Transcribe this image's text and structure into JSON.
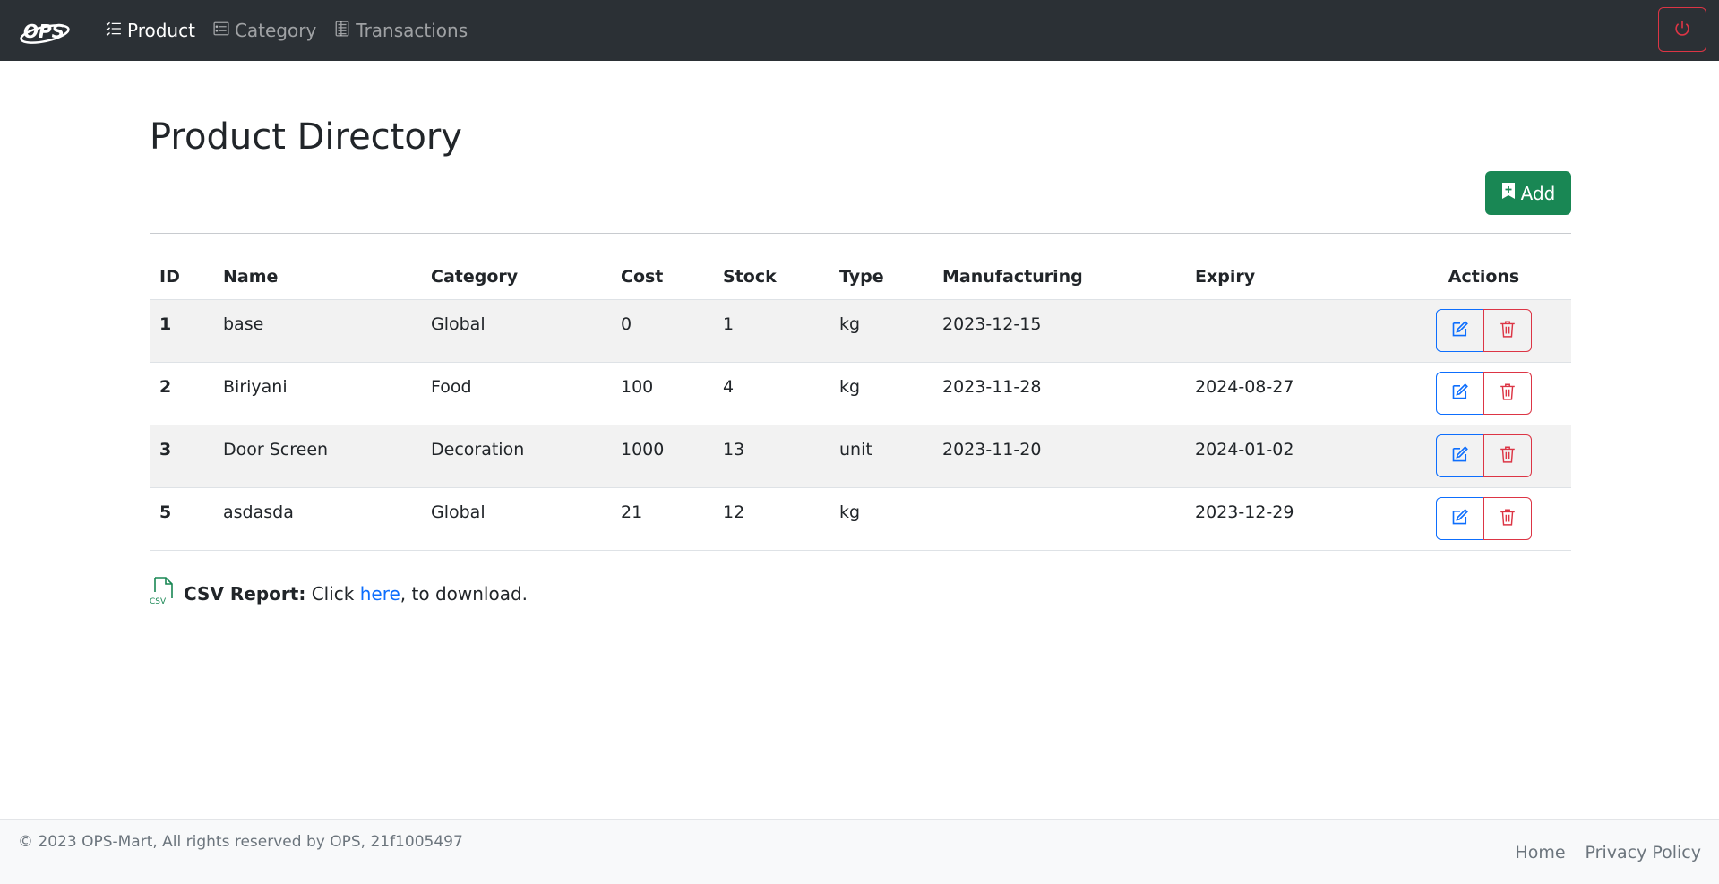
{
  "nav": {
    "brand": "OPS",
    "items": [
      {
        "label": "Product",
        "icon": "list-check-icon",
        "active": true
      },
      {
        "label": "Category",
        "icon": "card-list-icon",
        "active": false
      },
      {
        "label": "Transactions",
        "icon": "ledger-icon",
        "active": false
      }
    ],
    "power_icon": "power-icon"
  },
  "main": {
    "title": "Product Directory",
    "add_label": "Add",
    "table": {
      "headers": [
        "ID",
        "Name",
        "Category",
        "Cost",
        "Stock",
        "Type",
        "Manufacturing",
        "Expiry",
        "Actions"
      ],
      "rows": [
        {
          "id": "1",
          "name": "base",
          "category": "Global",
          "cost": "0",
          "stock": "1",
          "type": "kg",
          "manufacturing": "2023-12-15",
          "expiry": ""
        },
        {
          "id": "2",
          "name": "Biriyani",
          "category": "Food",
          "cost": "100",
          "stock": "4",
          "type": "kg",
          "manufacturing": "2023-11-28",
          "expiry": "2024-08-27"
        },
        {
          "id": "3",
          "name": "Door Screen",
          "category": "Decoration",
          "cost": "1000",
          "stock": "13",
          "type": "unit",
          "manufacturing": "2023-11-20",
          "expiry": "2024-01-02"
        },
        {
          "id": "5",
          "name": "asdasda",
          "category": "Global",
          "cost": "21",
          "stock": "12",
          "type": "kg",
          "manufacturing": "",
          "expiry": "2023-12-29"
        }
      ]
    },
    "csv": {
      "label": "CSV Report:",
      "text_before": " Click ",
      "link": "here",
      "text_after": ", to download.",
      "icon_text": "CSV"
    }
  },
  "footer": {
    "copyright": "© 2023 OPS-Mart, All rights reserved by OPS, 21f1005497",
    "links": [
      "Home",
      "Privacy Policy"
    ]
  },
  "colors": {
    "navbar": "#2b3035",
    "primary": "#0d6efd",
    "danger": "#dc3545",
    "success": "#198754"
  }
}
